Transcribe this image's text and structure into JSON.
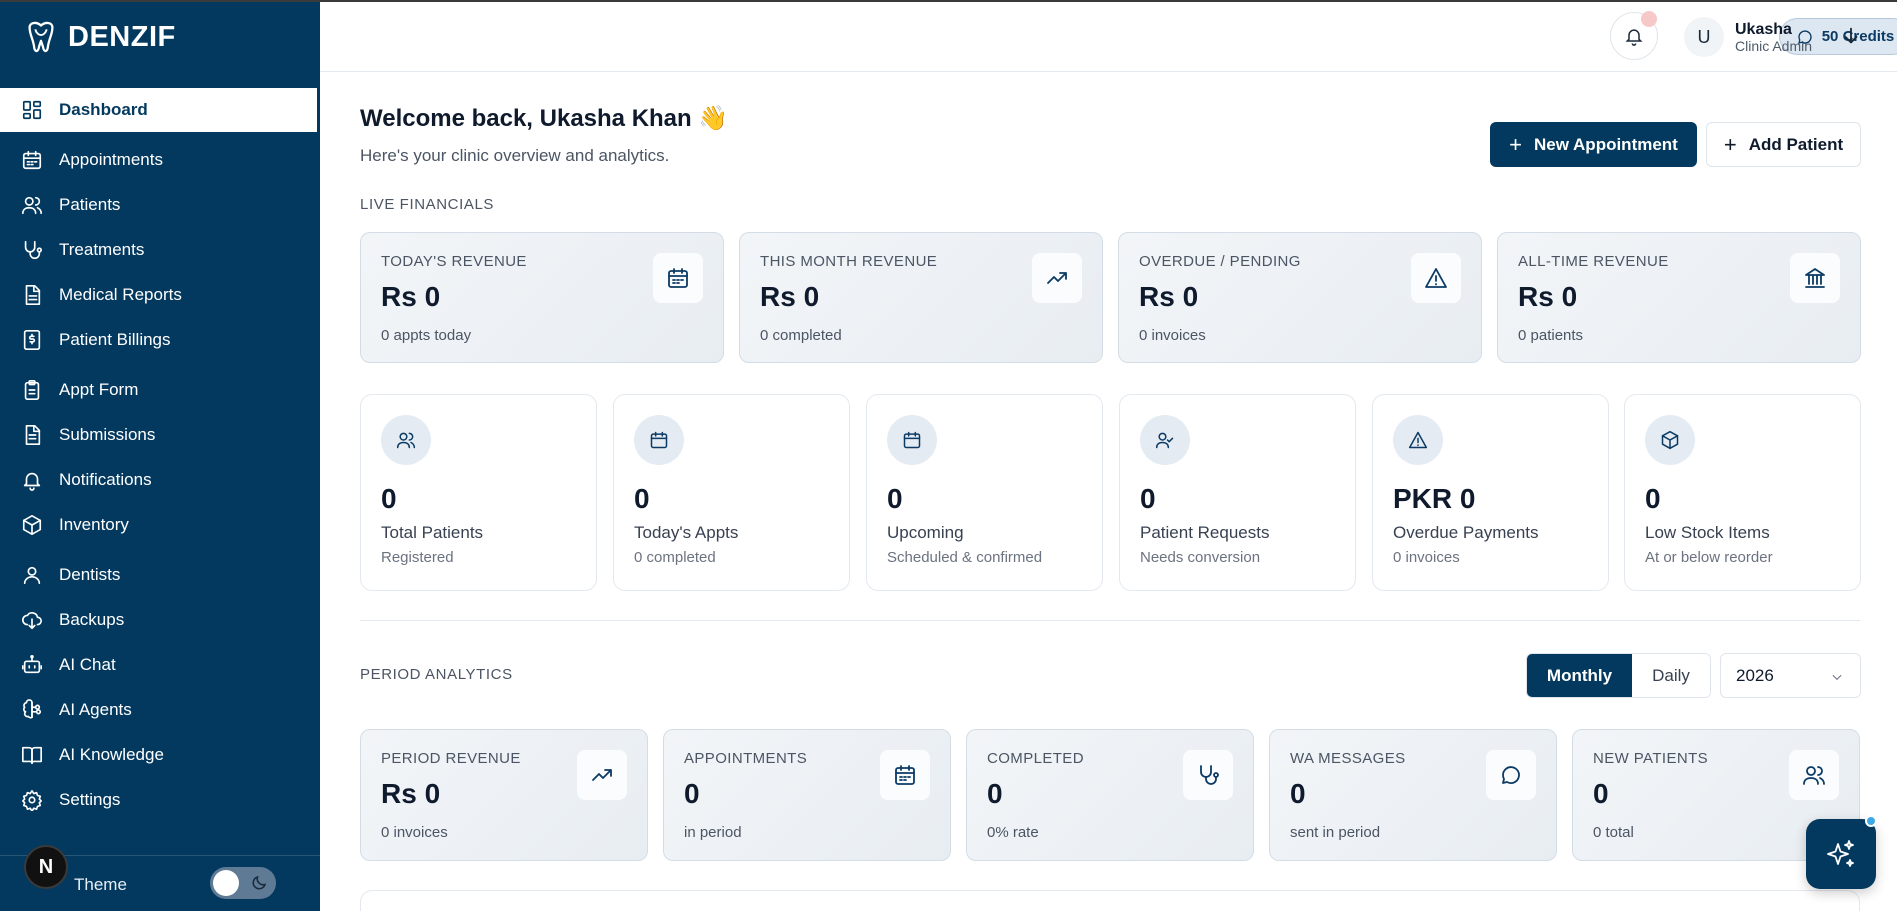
{
  "brand": {
    "name": "DENZIF"
  },
  "colors": {
    "primary": "#03395f",
    "accent": "#3ea8e5"
  },
  "sidebar": {
    "items": [
      {
        "label": "Dashboard",
        "icon": "dashboard-icon",
        "active": true
      },
      {
        "label": "Appointments",
        "icon": "calendar-icon"
      },
      {
        "label": "Patients",
        "icon": "users-icon"
      },
      {
        "label": "Treatments",
        "icon": "stethoscope-icon"
      },
      {
        "label": "Medical Reports",
        "icon": "document-icon"
      },
      {
        "label": "Patient Billings",
        "icon": "bill-icon"
      },
      {
        "label": "Appt Form",
        "icon": "clipboard-icon"
      },
      {
        "label": "Submissions",
        "icon": "file-list-icon"
      },
      {
        "label": "Notifications",
        "icon": "bell-icon"
      },
      {
        "label": "Inventory",
        "icon": "box-icon"
      },
      {
        "label": "Dentists",
        "icon": "user-icon"
      },
      {
        "label": "Backups",
        "icon": "cloud-download-icon"
      },
      {
        "label": "AI Chat",
        "icon": "bot-icon"
      },
      {
        "label": "AI Agents",
        "icon": "brain-icon"
      },
      {
        "label": "AI Knowledge",
        "icon": "book-icon"
      },
      {
        "label": "Settings",
        "icon": "gear-icon"
      }
    ],
    "theme_label": "Theme",
    "theme_badge": "N"
  },
  "topbar": {
    "credits": "50 Credits",
    "user_initial": "U",
    "user_name": "Ukasha",
    "user_role": "Clinic Admin"
  },
  "header": {
    "welcome": "Welcome back, Ukasha Khan 👋",
    "subtitle": "Here's your clinic overview and analytics.",
    "new_appointment": "New Appointment",
    "add_patient": "Add Patient"
  },
  "live_financials": {
    "label": "LIVE FINANCIALS",
    "cards": [
      {
        "title": "TODAY'S REVENUE",
        "value": "Rs 0",
        "sub": "0 appts today",
        "icon": "calendar-icon"
      },
      {
        "title": "THIS MONTH REVENUE",
        "value": "Rs 0",
        "sub": "0 completed",
        "icon": "trending-up-icon"
      },
      {
        "title": "OVERDUE / PENDING",
        "value": "Rs 0",
        "sub": "0 invoices",
        "icon": "warning-icon"
      },
      {
        "title": "ALL-TIME REVENUE",
        "value": "Rs 0",
        "sub": "0 patients",
        "icon": "bank-icon"
      }
    ]
  },
  "stats": [
    {
      "value": "0",
      "title": "Total Patients",
      "sub": "Registered",
      "icon": "users-icon"
    },
    {
      "value": "0",
      "title": "Today's Appts",
      "sub": "0 completed",
      "icon": "calendar-icon"
    },
    {
      "value": "0",
      "title": "Upcoming",
      "sub": "Scheduled & confirmed",
      "icon": "calendar-icon"
    },
    {
      "value": "0",
      "title": "Patient Requests",
      "sub": "Needs conversion",
      "icon": "user-check-icon"
    },
    {
      "value": "PKR 0",
      "title": "Overdue Payments",
      "sub": "0 invoices",
      "icon": "warning-icon"
    },
    {
      "value": "0",
      "title": "Low Stock Items",
      "sub": "At or below reorder",
      "icon": "box-icon"
    }
  ],
  "period_analytics": {
    "label": "PERIOD ANALYTICS",
    "toggle": {
      "monthly": "Monthly",
      "daily": "Daily",
      "selected": "Monthly"
    },
    "year": "2026",
    "cards": [
      {
        "title": "PERIOD REVENUE",
        "value": "Rs 0",
        "sub": "0 invoices",
        "icon": "trending-up-icon"
      },
      {
        "title": "APPOINTMENTS",
        "value": "0",
        "sub": "in period",
        "icon": "calendar-icon"
      },
      {
        "title": "COMPLETED",
        "value": "0",
        "sub": "0% rate",
        "icon": "stethoscope-icon"
      },
      {
        "title": "WA MESSAGES",
        "value": "0",
        "sub": "sent in period",
        "icon": "chat-icon"
      },
      {
        "title": "NEW PATIENTS",
        "value": "0",
        "sub": "0 total",
        "icon": "users-icon"
      }
    ]
  }
}
